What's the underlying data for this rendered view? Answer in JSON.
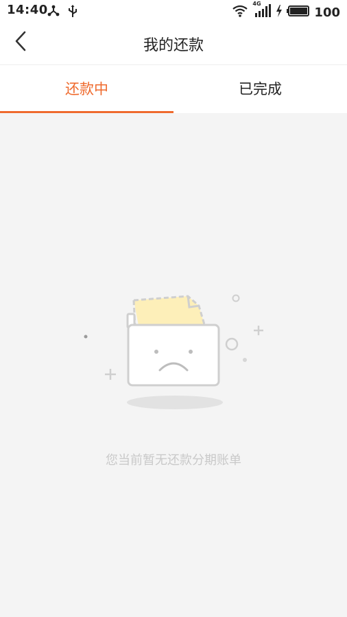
{
  "status_bar": {
    "time": "14:40",
    "battery_level": "100",
    "network_type": "4G",
    "icons": [
      "share-icon",
      "usb-icon",
      "wifi-icon",
      "signal-icon",
      "charging-icon",
      "battery-icon"
    ]
  },
  "header": {
    "title": "我的还款",
    "back_icon": "back-chevron-icon"
  },
  "tabs": [
    {
      "label": "还款中",
      "active": true
    },
    {
      "label": "已完成",
      "active": false
    }
  ],
  "empty_state": {
    "message": "您当前暂无还款分期账单",
    "illustration": "sad-folder-icon"
  },
  "colors": {
    "accent": "#ef6a2d",
    "background": "#f4f4f4",
    "empty_text": "#c9c9c9",
    "document": "#fdefb9"
  }
}
